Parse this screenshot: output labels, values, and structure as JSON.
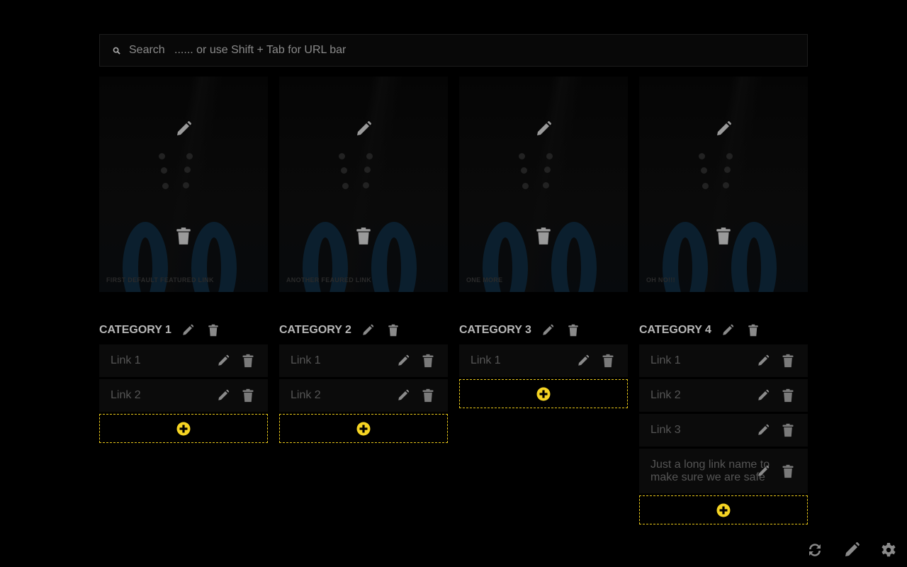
{
  "search": {
    "placeholder": "Search   ...... or use Shift + Tab for URL bar"
  },
  "featured": [
    {
      "label": "FIRST DEFAULT FEATURED LINK"
    },
    {
      "label": "ANOTHER FEAURED LINK"
    },
    {
      "label": "ONE MORE"
    },
    {
      "label": "OH NO!!!"
    }
  ],
  "categories": [
    {
      "title": "CATEGORY 1",
      "links": [
        "Link 1",
        "Link 2"
      ]
    },
    {
      "title": "CATEGORY 2",
      "links": [
        "Link 1",
        "Link 2"
      ]
    },
    {
      "title": "CATEGORY 3",
      "links": [
        "Link 1"
      ]
    },
    {
      "title": "CATEGORY 4",
      "links": [
        "Link 1",
        "Link 2",
        "Link 3",
        "Just a long link name to make sure we are safe"
      ]
    }
  ],
  "colors": {
    "accent": "#f5d423",
    "icon": "#8a8a8a"
  }
}
